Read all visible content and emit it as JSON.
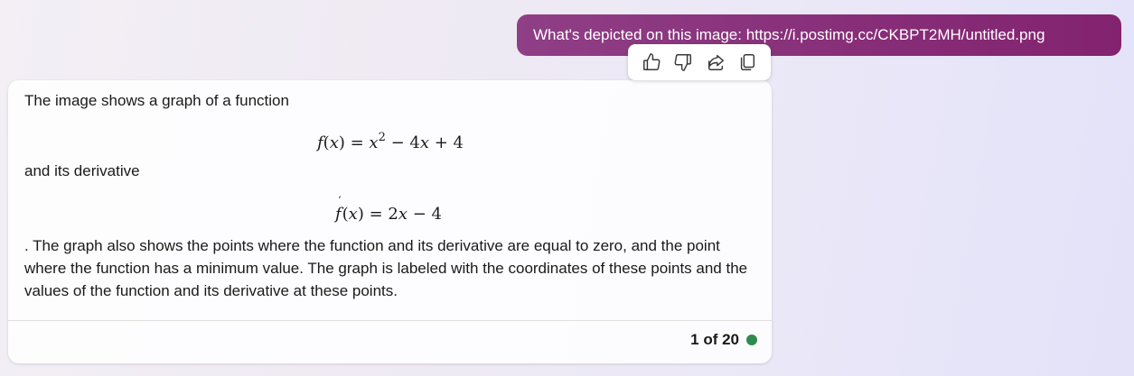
{
  "user_message": {
    "text": "What's depicted on this image: https://i.postimg.cc/CKBPT2MH/untitled.png"
  },
  "reactions": {
    "items": [
      {
        "icon": "thumbs-up-icon"
      },
      {
        "icon": "thumbs-down-icon"
      },
      {
        "icon": "share-icon"
      },
      {
        "icon": "copy-icon"
      }
    ]
  },
  "bot_response": {
    "paragraph_1": "The image shows a graph of a function",
    "math_1": {
      "f": "f",
      "x_open": "(",
      "x": "x",
      "x_close": ")",
      "eq": " = ",
      "x2": "x",
      "exp": "2",
      "rest_a": " − 4",
      "rest_x": "x",
      "rest_b": " + 4"
    },
    "paragraph_2": "and its derivative",
    "math_2": {
      "f": "f",
      "prime": "′",
      "x_open": "(",
      "x": "x",
      "x_close": ")",
      "eq": " = 2",
      "x2": "x",
      "rest": " − 4"
    },
    "paragraph_3": ". The graph also shows the points where the function and its derivative are equal to zero, and the point where the function has a minimum value. The graph is labeled with the coordinates of these points and the values of the function and its derivative at these points."
  },
  "footer": {
    "counter": "1 of 20",
    "status_color": "#2e8b4e"
  }
}
